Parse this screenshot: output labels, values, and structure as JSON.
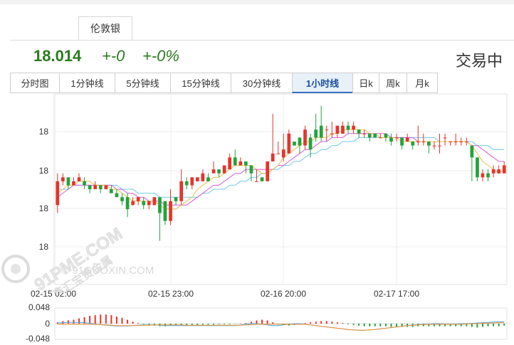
{
  "metal_tab": "伦敦银",
  "quote": {
    "price": "18.014",
    "change": "+-0",
    "change_pct": "+-0%",
    "status": "交易中"
  },
  "periods": [
    {
      "label": "分时图",
      "active": false
    },
    {
      "label": "1分钟线",
      "active": false
    },
    {
      "label": "5分钟线",
      "active": false
    },
    {
      "label": "15分钟线",
      "active": false
    },
    {
      "label": "30分钟线",
      "active": false
    },
    {
      "label": "1小时线",
      "active": true
    },
    {
      "label": "日k",
      "active": false
    },
    {
      "label": "周k",
      "active": false
    },
    {
      "label": "月k",
      "active": false
    }
  ],
  "watermark_text": "© 91GUOXIN.COM",
  "logo_text": "91PME.COM",
  "logo_subtext": "鑫汇宝贵金属",
  "colors": {
    "up": "#e8322b",
    "down": "#22a33a",
    "ma_short": "#e3c04a",
    "ma_mid": "#d65bd6",
    "ma_long": "#6fc8e6",
    "price": "#2a7a1e"
  },
  "chart_data": {
    "type": "candlestick",
    "ytick_labels": [
      "18",
      "18",
      "18",
      "18"
    ],
    "xtick_labels": [
      "02-15 02:00",
      "02-15 23:00",
      "02-16 20:00",
      "02-17 17:00"
    ],
    "ylim": [
      17.8,
      18.28
    ],
    "candles": [
      [
        18.0,
        18.06,
        18.08,
        17.98
      ],
      [
        18.06,
        18.07,
        18.08,
        18.05
      ],
      [
        18.07,
        18.05,
        18.07,
        18.04
      ],
      [
        18.05,
        18.06,
        18.07,
        18.05
      ],
      [
        18.06,
        18.07,
        18.08,
        18.06
      ],
      [
        18.06,
        18.05,
        18.07,
        18.04
      ],
      [
        18.05,
        18.04,
        18.05,
        18.03
      ],
      [
        18.04,
        18.05,
        18.06,
        18.04
      ],
      [
        18.05,
        18.04,
        18.05,
        18.03
      ],
      [
        18.04,
        18.05,
        18.05,
        18.04
      ],
      [
        18.04,
        18.03,
        18.05,
        18.03
      ],
      [
        18.03,
        18.02,
        18.04,
        18.02
      ],
      [
        18.02,
        18.01,
        18.03,
        18.0
      ],
      [
        18.02,
        17.99,
        18.03,
        17.97
      ],
      [
        18.0,
        18.01,
        18.02,
        18.0
      ],
      [
        18.01,
        18.02,
        18.02,
        18.0
      ],
      [
        18.01,
        18.0,
        18.02,
        17.99
      ],
      [
        18.0,
        18.01,
        18.01,
        17.99
      ],
      [
        18.0,
        18.02,
        18.02,
        18.0
      ],
      [
        18.02,
        17.98,
        18.02,
        17.91
      ],
      [
        18.01,
        17.96,
        18.01,
        17.95
      ],
      [
        17.96,
        18.01,
        18.04,
        17.95
      ],
      [
        18.02,
        18.01,
        18.02,
        18.0
      ],
      [
        18.01,
        18.06,
        18.09,
        18.0
      ],
      [
        18.06,
        18.05,
        18.07,
        18.04
      ],
      [
        18.05,
        18.07,
        18.07,
        18.04
      ],
      [
        18.06,
        18.07,
        18.07,
        18.06
      ],
      [
        18.06,
        18.08,
        18.09,
        18.06
      ],
      [
        18.07,
        18.06,
        18.08,
        18.06
      ],
      [
        18.08,
        18.09,
        18.11,
        18.08
      ],
      [
        18.09,
        18.08,
        18.09,
        18.07
      ],
      [
        18.08,
        18.1,
        18.1,
        18.08
      ],
      [
        18.09,
        18.12,
        18.13,
        18.09
      ],
      [
        18.12,
        18.1,
        18.14,
        18.1
      ],
      [
        18.1,
        18.11,
        18.12,
        18.1
      ],
      [
        18.11,
        18.1,
        18.11,
        18.08
      ],
      [
        18.1,
        18.08,
        18.1,
        18.06
      ],
      [
        18.06,
        18.06,
        18.09,
        18.06
      ],
      [
        18.07,
        18.06,
        18.07,
        18.06
      ],
      [
        18.06,
        18.11,
        18.11,
        18.06
      ],
      [
        18.11,
        18.13,
        18.23,
        18.11
      ],
      [
        18.13,
        18.13,
        18.16,
        18.13
      ],
      [
        18.12,
        18.14,
        18.18,
        18.11
      ],
      [
        18.13,
        18.18,
        18.19,
        18.13
      ],
      [
        18.16,
        18.15,
        18.16,
        18.15
      ],
      [
        18.17,
        18.15,
        18.17,
        18.13
      ],
      [
        18.15,
        18.19,
        18.2,
        18.14
      ],
      [
        18.17,
        18.14,
        18.18,
        18.12
      ],
      [
        18.19,
        18.17,
        18.23,
        18.16
      ],
      [
        18.2,
        18.17,
        18.25,
        18.16
      ],
      [
        18.19,
        18.19,
        18.2,
        18.16
      ],
      [
        18.18,
        18.18,
        18.21,
        18.17
      ],
      [
        18.18,
        18.2,
        18.2,
        18.17
      ],
      [
        18.18,
        18.2,
        18.21,
        18.18
      ],
      [
        18.2,
        18.19,
        18.21,
        18.18
      ],
      [
        18.19,
        18.2,
        18.21,
        18.18
      ],
      [
        18.19,
        18.18,
        18.19,
        18.17
      ],
      [
        18.18,
        18.18,
        18.19,
        18.17
      ],
      [
        18.18,
        18.17,
        18.18,
        18.16
      ],
      [
        18.18,
        18.17,
        18.18,
        18.17
      ],
      [
        18.17,
        18.17,
        18.18,
        18.17
      ],
      [
        18.18,
        18.17,
        18.18,
        18.16
      ],
      [
        18.17,
        18.16,
        18.18,
        18.15
      ],
      [
        18.17,
        18.17,
        18.18,
        18.16
      ],
      [
        18.17,
        18.15,
        18.17,
        18.14
      ],
      [
        18.16,
        18.17,
        18.18,
        18.16
      ],
      [
        18.16,
        18.15,
        18.16,
        18.14
      ],
      [
        18.16,
        18.16,
        18.2,
        18.15
      ],
      [
        18.16,
        18.16,
        18.18,
        18.15
      ],
      [
        18.16,
        18.15,
        18.16,
        18.13
      ],
      [
        18.15,
        18.15,
        18.16,
        18.14
      ],
      [
        18.15,
        18.15,
        18.18,
        18.13
      ],
      [
        18.17,
        18.17,
        18.18,
        18.15
      ],
      [
        18.16,
        18.16,
        18.16,
        18.15
      ],
      [
        18.16,
        18.16,
        18.18,
        18.15
      ],
      [
        18.16,
        18.16,
        18.17,
        18.15
      ],
      [
        18.16,
        18.16,
        18.17,
        18.15
      ],
      [
        18.15,
        18.12,
        18.15,
        18.06
      ],
      [
        18.12,
        18.07,
        18.12,
        18.06
      ],
      [
        18.07,
        18.08,
        18.09,
        18.06
      ],
      [
        18.08,
        18.07,
        18.09,
        18.06
      ],
      [
        18.08,
        18.09,
        18.1,
        18.07
      ],
      [
        18.08,
        18.09,
        18.1,
        18.08
      ],
      [
        18.08,
        18.1,
        18.11,
        18.08
      ]
    ],
    "ma_short": [
      18.03,
      18.04,
      18.05,
      18.05,
      18.06,
      18.06,
      18.06,
      18.05,
      18.05,
      18.05,
      18.04,
      18.04,
      18.03,
      18.02,
      18.01,
      18.01,
      18.01,
      18.01,
      18.01,
      18.0,
      17.99,
      17.99,
      17.99,
      18.0,
      18.01,
      18.02,
      18.04,
      18.05,
      18.06,
      18.07,
      18.07,
      18.08,
      18.09,
      18.1,
      18.1,
      18.1,
      18.1,
      18.09,
      18.08,
      18.08,
      18.09,
      18.1,
      18.12,
      18.13,
      18.14,
      18.15,
      18.16,
      18.16,
      18.17,
      18.17,
      18.17,
      18.18,
      18.18,
      18.19,
      18.19,
      18.19,
      18.19,
      18.19,
      18.18,
      18.18,
      18.17,
      18.17,
      18.17,
      18.17,
      18.16,
      18.16,
      18.16,
      18.16,
      18.16,
      18.16,
      18.16,
      18.16,
      18.16,
      18.16,
      18.16,
      18.16,
      18.16,
      18.15,
      18.13,
      18.11,
      18.1,
      18.09,
      18.08,
      18.09
    ],
    "ma_mid": [
      18.02,
      18.03,
      18.04,
      18.05,
      18.05,
      18.05,
      18.05,
      18.05,
      18.05,
      18.05,
      18.05,
      18.04,
      18.04,
      18.03,
      18.03,
      18.02,
      18.02,
      18.01,
      18.01,
      18.01,
      18.0,
      18.0,
      18.0,
      18.0,
      18.0,
      18.01,
      18.02,
      18.03,
      18.04,
      18.05,
      18.05,
      18.06,
      18.07,
      18.08,
      18.08,
      18.09,
      18.09,
      18.09,
      18.09,
      18.09,
      18.09,
      18.1,
      18.1,
      18.11,
      18.12,
      18.13,
      18.14,
      18.14,
      18.15,
      18.16,
      18.16,
      18.17,
      18.17,
      18.17,
      18.18,
      18.18,
      18.18,
      18.18,
      18.18,
      18.18,
      18.18,
      18.18,
      18.17,
      18.17,
      18.17,
      18.17,
      18.17,
      18.16,
      18.16,
      18.16,
      18.16,
      18.16,
      18.16,
      18.16,
      18.16,
      18.16,
      18.16,
      18.15,
      18.15,
      18.14,
      18.13,
      18.12,
      18.11,
      18.11
    ],
    "ma_long": [
      18.04,
      18.04,
      18.04,
      18.05,
      18.05,
      18.05,
      18.05,
      18.05,
      18.05,
      18.05,
      18.05,
      18.05,
      18.04,
      18.04,
      18.04,
      18.03,
      18.03,
      18.03,
      18.03,
      18.02,
      18.02,
      18.02,
      18.02,
      18.02,
      18.02,
      18.02,
      18.02,
      18.03,
      18.03,
      18.04,
      18.04,
      18.04,
      18.05,
      18.05,
      18.06,
      18.06,
      18.07,
      18.07,
      18.08,
      18.08,
      18.09,
      18.09,
      18.1,
      18.1,
      18.11,
      18.11,
      18.12,
      18.13,
      18.13,
      18.14,
      18.14,
      18.15,
      18.15,
      18.16,
      18.16,
      18.16,
      18.17,
      18.17,
      18.17,
      18.17,
      18.17,
      18.17,
      18.17,
      18.17,
      18.17,
      18.17,
      18.17,
      18.17,
      18.17,
      18.17,
      18.17,
      18.16,
      18.16,
      18.16,
      18.16,
      18.16,
      18.16,
      18.16,
      18.15,
      18.15,
      18.15,
      18.14,
      18.14,
      18.14
    ],
    "sub_ytick_labels": [
      "0.048",
      "0",
      "-0.048"
    ],
    "sub_ylim": [
      -0.048,
      0.048
    ],
    "macd_hist": [
      0.004,
      0.008,
      0.01,
      0.012,
      0.016,
      0.02,
      0.024,
      0.026,
      0.028,
      0.028,
      0.026,
      0.022,
      0.018,
      0.012,
      0.006,
      0.002,
      -0.002,
      -0.004,
      -0.006,
      -0.008,
      -0.008,
      -0.006,
      -0.005,
      -0.004,
      -0.004,
      -0.004,
      -0.004,
      -0.003,
      -0.003,
      -0.003,
      -0.002,
      -0.002,
      -0.002,
      -0.001,
      0.001,
      0.002,
      0.006,
      0.01,
      0.012,
      0.01,
      0.004,
      -0.002,
      -0.004,
      -0.006,
      -0.004,
      -0.002,
      0.002,
      0.004,
      0.006,
      0.008,
      0.008,
      0.006,
      0.004,
      0.002,
      -0.002,
      -0.004,
      -0.006,
      -0.008,
      -0.008,
      -0.008,
      -0.008,
      -0.008,
      -0.01,
      -0.01,
      -0.01,
      -0.01,
      -0.01,
      -0.008,
      -0.008,
      -0.008,
      -0.008,
      -0.008,
      -0.008,
      -0.008,
      -0.008,
      -0.008,
      -0.008,
      -0.01,
      -0.012,
      -0.01,
      -0.008,
      -0.008,
      -0.008,
      -0.006
    ],
    "dif": [
      0.002,
      0.003,
      0.004,
      0.004,
      0.004,
      0.003,
      0.001,
      -0.001,
      -0.003,
      -0.005,
      -0.006,
      -0.007,
      -0.007,
      -0.007,
      -0.006,
      -0.005,
      -0.004,
      -0.004,
      -0.004,
      -0.005,
      -0.006,
      -0.006,
      -0.006,
      -0.006,
      -0.006,
      -0.006,
      -0.006,
      -0.006,
      -0.006,
      -0.006,
      -0.006,
      -0.006,
      -0.006,
      -0.006,
      -0.004,
      -0.002,
      0.0,
      0.0,
      -0.002,
      -0.004,
      -0.006,
      -0.006,
      -0.004,
      -0.002,
      0.0,
      0.0,
      -0.002,
      -0.004,
      -0.006,
      -0.008,
      -0.01,
      -0.012,
      -0.014,
      -0.016,
      -0.018,
      -0.019,
      -0.02,
      -0.02,
      -0.019,
      -0.018,
      -0.016,
      -0.014,
      -0.012,
      -0.01,
      -0.008,
      -0.006,
      -0.004,
      -0.003,
      -0.002,
      -0.001,
      0.0,
      0.0,
      -0.001,
      -0.001,
      -0.001,
      0.0,
      0.0,
      0.001,
      0.002,
      0.003,
      0.004,
      0.005,
      0.006,
      0.006
    ],
    "dea": [
      -0.002,
      -0.002,
      -0.002,
      -0.002,
      -0.002,
      -0.002,
      -0.002,
      -0.002,
      -0.003,
      -0.004,
      -0.005,
      -0.006,
      -0.006,
      -0.006,
      -0.006,
      -0.006,
      -0.005,
      -0.005,
      -0.004,
      -0.004,
      -0.004,
      -0.004,
      -0.004,
      -0.004,
      -0.005,
      -0.005,
      -0.005,
      -0.005,
      -0.005,
      -0.005,
      -0.005,
      -0.005,
      -0.005,
      -0.005,
      -0.005,
      -0.004,
      -0.003,
      -0.002,
      -0.002,
      -0.002,
      -0.002,
      -0.002,
      -0.002,
      -0.002,
      -0.002,
      -0.002,
      -0.002,
      -0.004,
      -0.006,
      -0.008,
      -0.01,
      -0.012,
      -0.014,
      -0.016,
      -0.018,
      -0.019,
      -0.02,
      -0.02,
      -0.019,
      -0.018,
      -0.016,
      -0.014,
      -0.012,
      -0.01,
      -0.008,
      -0.006,
      -0.005,
      -0.004,
      -0.003,
      -0.002,
      -0.002,
      -0.002,
      -0.002,
      -0.002,
      -0.002,
      -0.002,
      -0.001,
      0.0,
      0.0,
      0.001,
      0.002,
      0.002,
      0.003,
      0.003
    ]
  }
}
